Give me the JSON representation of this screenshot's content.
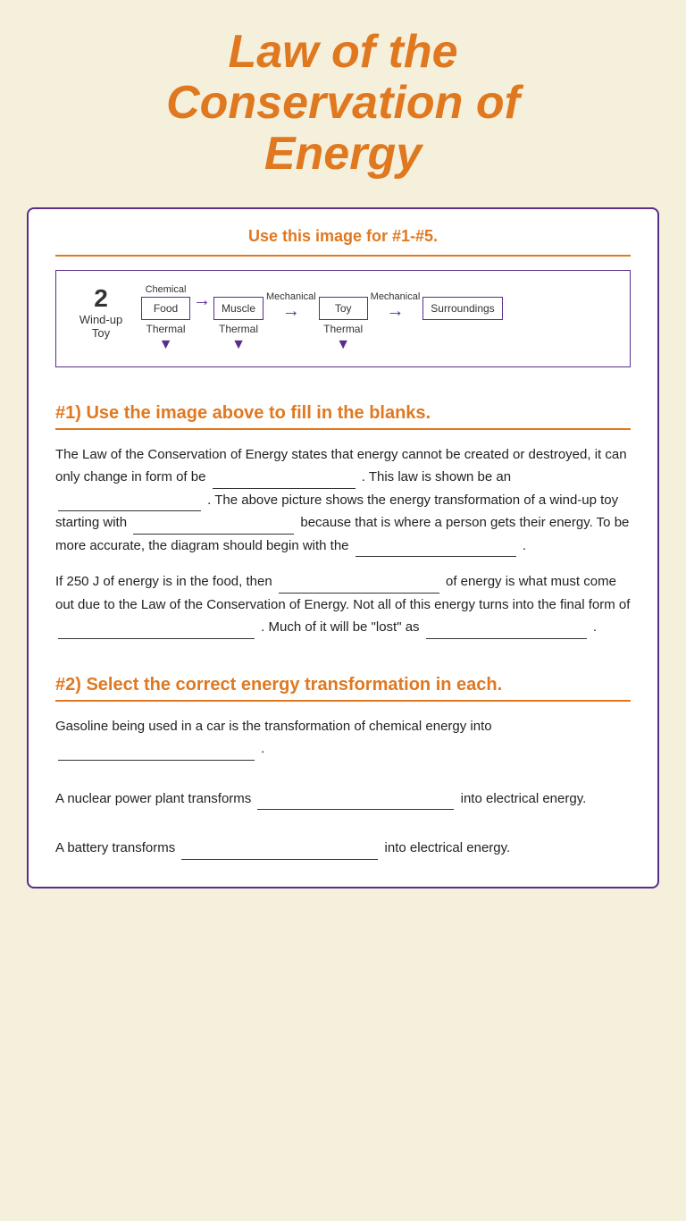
{
  "header": {
    "title_line1": "Law of the",
    "title_line2": "Conservation of",
    "title_line3": "Energy"
  },
  "diagram_section": {
    "instruction": "Use this image for #1-#5.",
    "diagram": {
      "number": "2",
      "label": "Wind-up\nToy",
      "nodes": [
        {
          "box": "Food",
          "label_top": "Chemical",
          "thermal": "Thermal"
        },
        {
          "arrow_label": "",
          "arrow": "→"
        },
        {
          "box": "Muscle",
          "label_top": "",
          "thermal": "Thermal"
        },
        {
          "arrow_label": "Mechanical",
          "arrow": "→"
        },
        {
          "box": "Toy",
          "label_top": "",
          "thermal": "Thermal"
        },
        {
          "arrow_label": "Mechanical",
          "arrow": "→"
        },
        {
          "box": "Surroundings",
          "label_top": ""
        }
      ]
    }
  },
  "question1": {
    "heading": "#1) Use the image above to fill in the blanks.",
    "paragraph1": "The Law of the Conservation of Energy states that energy cannot be created or destroyed, it can only change in form of be",
    "paragraph1_cont": ". This law is shown be an",
    "paragraph1_cont2": ". The above picture shows the energy transformation of a wind-up toy starting with",
    "paragraph1_cont3": "because that is where a person gets their energy. To be more accurate, the diagram should begin with the",
    "paragraph1_cont4": ".",
    "paragraph2": "If 250 J of energy is in the food, then",
    "paragraph2_cont": "of energy is what must come out due to the Law of the Conservation of Energy. Not all of this energy turns into the final form of",
    "paragraph2_cont2": ".",
    "paragraph3": "Much of it will be \"lost\" as",
    "paragraph3_cont": "."
  },
  "question2": {
    "heading": "#2) Select the correct energy transformation in each.",
    "q1_text1": "Gasoline being used in a car is the transformation of chemical energy into",
    "q1_text2": ".",
    "q2_text1": "A nuclear power plant transforms",
    "q2_text2": "into electrical energy.",
    "q3_text1": "A battery transforms",
    "q3_text2": "into electrical energy."
  },
  "colors": {
    "orange": "#e07820",
    "purple": "#5a2d8c",
    "background": "#f5f0dc"
  }
}
